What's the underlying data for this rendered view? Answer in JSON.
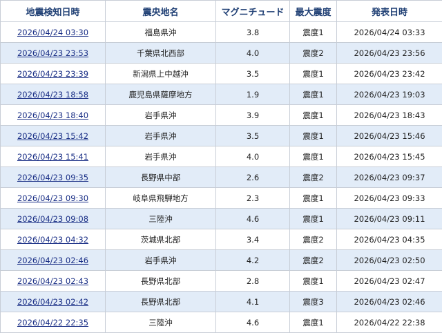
{
  "table": {
    "headers": [
      "地震検知日時",
      "震央地名",
      "マグニチュード",
      "最大震度",
      "発表日時"
    ],
    "rows": [
      {
        "detected": "2026/04/24 03:30",
        "epicenter": "福島県沖",
        "magnitude": "3.8",
        "intensity": "震度1",
        "announced": "2026/04/24 03:33"
      },
      {
        "detected": "2026/04/23 23:53",
        "epicenter": "千葉県北西部",
        "magnitude": "4.0",
        "intensity": "震度2",
        "announced": "2026/04/23 23:56"
      },
      {
        "detected": "2026/04/23 23:39",
        "epicenter": "新潟県上中越沖",
        "magnitude": "3.5",
        "intensity": "震度1",
        "announced": "2026/04/23 23:42"
      },
      {
        "detected": "2026/04/23 18:58",
        "epicenter": "鹿児島県薩摩地方",
        "magnitude": "1.9",
        "intensity": "震度1",
        "announced": "2026/04/23 19:03"
      },
      {
        "detected": "2026/04/23 18:40",
        "epicenter": "岩手県沖",
        "magnitude": "3.9",
        "intensity": "震度1",
        "announced": "2026/04/23 18:43"
      },
      {
        "detected": "2026/04/23 15:42",
        "epicenter": "岩手県沖",
        "magnitude": "3.5",
        "intensity": "震度1",
        "announced": "2026/04/23 15:46"
      },
      {
        "detected": "2026/04/23 15:41",
        "epicenter": "岩手県沖",
        "magnitude": "4.0",
        "intensity": "震度1",
        "announced": "2026/04/23 15:45"
      },
      {
        "detected": "2026/04/23 09:35",
        "epicenter": "長野県中部",
        "magnitude": "2.6",
        "intensity": "震度2",
        "announced": "2026/04/23 09:37"
      },
      {
        "detected": "2026/04/23 09:30",
        "epicenter": "岐阜県飛騨地方",
        "magnitude": "2.3",
        "intensity": "震度1",
        "announced": "2026/04/23 09:33"
      },
      {
        "detected": "2026/04/23 09:08",
        "epicenter": "三陸沖",
        "magnitude": "4.6",
        "intensity": "震度1",
        "announced": "2026/04/23 09:11"
      },
      {
        "detected": "2026/04/23 04:32",
        "epicenter": "茨城県北部",
        "magnitude": "3.4",
        "intensity": "震度2",
        "announced": "2026/04/23 04:35"
      },
      {
        "detected": "2026/04/23 02:46",
        "epicenter": "岩手県沖",
        "magnitude": "4.2",
        "intensity": "震度2",
        "announced": "2026/04/23 02:50"
      },
      {
        "detected": "2026/04/23 02:43",
        "epicenter": "長野県北部",
        "magnitude": "2.8",
        "intensity": "震度1",
        "announced": "2026/04/23 02:47"
      },
      {
        "detected": "2026/04/23 02:42",
        "epicenter": "長野県北部",
        "magnitude": "4.1",
        "intensity": "震度3",
        "announced": "2026/04/23 02:46"
      },
      {
        "detected": "2026/04/22 22:35",
        "epicenter": "三陸沖",
        "magnitude": "4.6",
        "intensity": "震度1",
        "announced": "2026/04/22 22:38"
      }
    ]
  },
  "colors": {
    "header_text": "#1f3f74",
    "row_stripe": "#e2ecf8",
    "link": "#1a2f86",
    "border": "#c7cdd6"
  }
}
